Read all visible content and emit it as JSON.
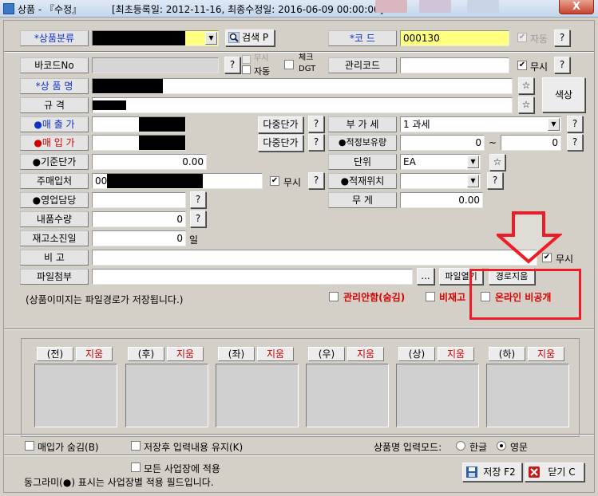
{
  "window": {
    "title": "상품 - 『수정』",
    "info": "[최초등록일: 2012-11-16, 최종수정일: 2016-06-09 00:00:00]",
    "close_label": "X"
  },
  "icons": {
    "app": "app-icon",
    "search": "magnifier-icon",
    "star": "star-icon",
    "save": "floppy-icon",
    "close": "close-x-icon",
    "dropdown": "chevron-down-icon"
  },
  "colors": {
    "label_blue": "#1030c8",
    "label_red": "#d00000",
    "required_yellow": "#ffff80",
    "annotation_red": "#ee1c24"
  },
  "left": {
    "category_label": "*상품분류",
    "barcode_label": "바코드No",
    "name_label": "*상 품 명",
    "spec_label": "규    격",
    "sale_price_label": "●매 출 가",
    "purchase_price_label": "●매 입 가",
    "base_price_label": "●기준단가",
    "base_price_value": "0.00",
    "supplier_label": "주매입처",
    "supplier_value": "00",
    "sales_rep_label": "●영업담당",
    "delivery_qty_label": "내품수량",
    "delivery_qty_value": "0",
    "stock_days_label": "재고소진일",
    "stock_days_value": "0",
    "stock_days_unit": "일",
    "note_label": "비    고",
    "attach_label": "파일첨부",
    "image_note": "(상품이미지는 파일경로가 저장됩니다.)"
  },
  "buttons": {
    "search": "검색 P",
    "help": "?",
    "multi_price_1": "다중단가",
    "multi_price_2": "다중단가",
    "browse": "...",
    "file_open": "파일열기",
    "path_clear": "경로지움",
    "color": "색상",
    "save": "저장 F2",
    "close": "닫기 C"
  },
  "checks": {
    "barcode_ignore": "무시",
    "barcode_auto": "자동",
    "check_dgt_1": "체크",
    "check_dgt_2": "DGT",
    "code_auto": "자동",
    "mgmt_code_ignore": "무시",
    "supplier_ignore": "무시",
    "note_ignore": "무시",
    "manage_hide": "관리안함(숨김)",
    "non_stock": "비재고",
    "online_private": "온라인 비공개"
  },
  "right": {
    "code_label": "*코    드",
    "code_value": "000130",
    "mgmt_code_label": "관리코드",
    "vat_label": "부 가 세",
    "vat_value": "1 과세",
    "safe_stock_label": "●적정보유량",
    "safe_stock_min": "0",
    "safe_stock_sep": "~",
    "safe_stock_max": "0",
    "unit_label": "단위",
    "unit_value": "EA",
    "location_label": "●적재위치",
    "weight_label": "무    게",
    "weight_value": "0.00"
  },
  "images": [
    {
      "caption": "(전)",
      "delete": "지움"
    },
    {
      "caption": "(후)",
      "delete": "지움"
    },
    {
      "caption": "(좌)",
      "delete": "지움"
    },
    {
      "caption": "(우)",
      "delete": "지움"
    },
    {
      "caption": "(상)",
      "delete": "지움"
    },
    {
      "caption": "(하)",
      "delete": "지움"
    }
  ],
  "bottom": {
    "hide_purchase_price": "매입가 숨김(B)",
    "keep_input": "저장후 입력내용 유지(K)",
    "input_mode_label": "상품명 입력모드:",
    "mode_korean": "한글",
    "mode_english": "영문",
    "apply_all": "모든 사업장에 적용",
    "footer_note": "동그라미(●) 표시는 사업장별 적용 필드입니다."
  }
}
